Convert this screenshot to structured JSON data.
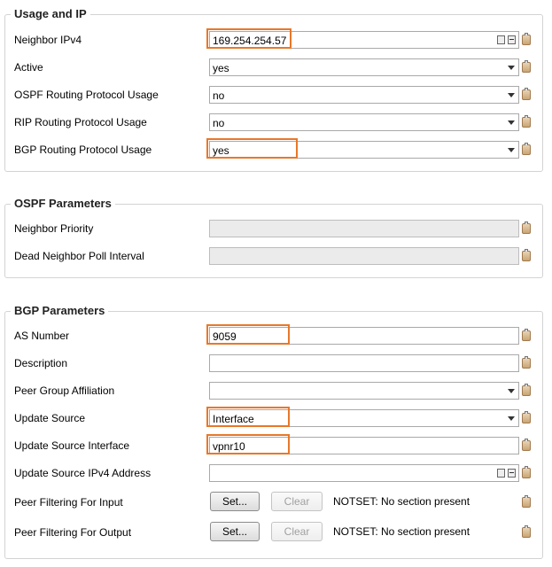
{
  "usage": {
    "title": "Usage and IP",
    "neighbor_ipv4": {
      "label": "Neighbor IPv4",
      "value": "169.254.254.57"
    },
    "active": {
      "label": "Active",
      "value": "yes"
    },
    "ospf_usage": {
      "label": "OSPF Routing Protocol Usage",
      "value": "no"
    },
    "rip_usage": {
      "label": "RIP Routing Protocol Usage",
      "value": "no"
    },
    "bgp_usage": {
      "label": "BGP Routing Protocol Usage",
      "value": "yes"
    }
  },
  "ospf": {
    "title": "OSPF Parameters",
    "neighbor_priority": {
      "label": "Neighbor Priority",
      "value": ""
    },
    "dead_poll": {
      "label": "Dead Neighbor Poll Interval",
      "value": ""
    }
  },
  "bgp": {
    "title": "BGP Parameters",
    "as_number": {
      "label": "AS Number",
      "value": "9059"
    },
    "description": {
      "label": "Description",
      "value": ""
    },
    "peer_group": {
      "label": "Peer Group Affiliation",
      "value": ""
    },
    "update_source": {
      "label": "Update Source",
      "value": "Interface"
    },
    "update_source_interface": {
      "label": "Update Source Interface",
      "value": "vpnr10"
    },
    "update_source_ipv4": {
      "label": "Update Source IPv4 Address",
      "value": ""
    },
    "filter_input": {
      "label": "Peer Filtering For Input",
      "set": "Set...",
      "clear": "Clear",
      "status": "NOTSET: No section present"
    },
    "filter_output": {
      "label": "Peer Filtering For Output",
      "set": "Set...",
      "clear": "Clear",
      "status": "NOTSET: No section present"
    }
  },
  "colors": {
    "highlight": "#e8782a",
    "border": "#d3d3d3"
  }
}
